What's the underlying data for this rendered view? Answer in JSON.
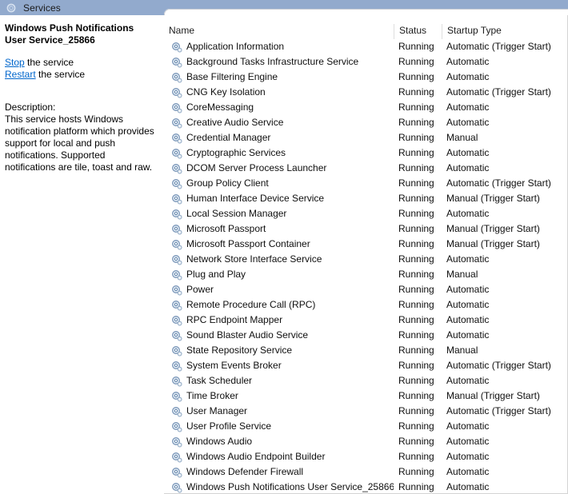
{
  "window": {
    "title": "Services",
    "icon": "services-gear-icon"
  },
  "detail_pane": {
    "service_name": "Windows Push Notifications User Service_25866",
    "actions": [
      {
        "link": "Stop",
        "suffix": " the service"
      },
      {
        "link": "Restart",
        "suffix": " the service"
      }
    ],
    "description_label": "Description:",
    "description_text": "This service hosts Windows notification platform which provides support for local and push notifications. Supported notifications are tile, toast and raw."
  },
  "list": {
    "columns": [
      {
        "key": "name",
        "label": "Name",
        "sorted": true,
        "sort_direction": "ascending"
      },
      {
        "key": "status",
        "label": "Status",
        "sorted": false
      },
      {
        "key": "startup",
        "label": "Startup Type",
        "sorted": false
      }
    ],
    "selected_index": 30,
    "selection_color": "#0078d7",
    "rows": [
      {
        "name": "Application Information",
        "status": "Running",
        "startup": "Automatic (Trigger Start)"
      },
      {
        "name": "Background Tasks Infrastructure Service",
        "status": "Running",
        "startup": "Automatic"
      },
      {
        "name": "Base Filtering Engine",
        "status": "Running",
        "startup": "Automatic"
      },
      {
        "name": "CNG Key Isolation",
        "status": "Running",
        "startup": "Automatic (Trigger Start)"
      },
      {
        "name": "CoreMessaging",
        "status": "Running",
        "startup": "Automatic"
      },
      {
        "name": "Creative Audio Service",
        "status": "Running",
        "startup": "Automatic"
      },
      {
        "name": "Credential Manager",
        "status": "Running",
        "startup": "Manual"
      },
      {
        "name": "Cryptographic Services",
        "status": "Running",
        "startup": "Automatic"
      },
      {
        "name": "DCOM Server Process Launcher",
        "status": "Running",
        "startup": "Automatic"
      },
      {
        "name": "Group Policy Client",
        "status": "Running",
        "startup": "Automatic (Trigger Start)"
      },
      {
        "name": "Human Interface Device Service",
        "status": "Running",
        "startup": "Manual (Trigger Start)"
      },
      {
        "name": "Local Session Manager",
        "status": "Running",
        "startup": "Automatic"
      },
      {
        "name": "Microsoft Passport",
        "status": "Running",
        "startup": "Manual (Trigger Start)"
      },
      {
        "name": "Microsoft Passport Container",
        "status": "Running",
        "startup": "Manual (Trigger Start)"
      },
      {
        "name": "Network Store Interface Service",
        "status": "Running",
        "startup": "Automatic"
      },
      {
        "name": "Plug and Play",
        "status": "Running",
        "startup": "Manual"
      },
      {
        "name": "Power",
        "status": "Running",
        "startup": "Automatic"
      },
      {
        "name": "Remote Procedure Call (RPC)",
        "status": "Running",
        "startup": "Automatic"
      },
      {
        "name": "RPC Endpoint Mapper",
        "status": "Running",
        "startup": "Automatic"
      },
      {
        "name": "Sound Blaster Audio Service",
        "status": "Running",
        "startup": "Automatic"
      },
      {
        "name": "State Repository Service",
        "status": "Running",
        "startup": "Manual"
      },
      {
        "name": "System Events Broker",
        "status": "Running",
        "startup": "Automatic (Trigger Start)"
      },
      {
        "name": "Task Scheduler",
        "status": "Running",
        "startup": "Automatic"
      },
      {
        "name": "Time Broker",
        "status": "Running",
        "startup": "Manual (Trigger Start)"
      },
      {
        "name": "User Manager",
        "status": "Running",
        "startup": "Automatic (Trigger Start)"
      },
      {
        "name": "User Profile Service",
        "status": "Running",
        "startup": "Automatic"
      },
      {
        "name": "Windows Audio",
        "status": "Running",
        "startup": "Automatic"
      },
      {
        "name": "Windows Audio Endpoint Builder",
        "status": "Running",
        "startup": "Automatic"
      },
      {
        "name": "Windows Defender Firewall",
        "status": "Running",
        "startup": "Automatic"
      },
      {
        "name": "Windows Push Notifications User Service_25866",
        "status": "Running",
        "startup": "Automatic"
      }
    ]
  }
}
